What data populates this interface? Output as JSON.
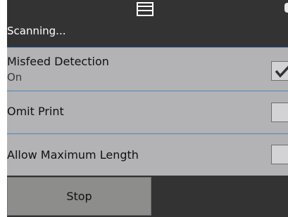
{
  "header": {
    "icon": "document-tray-icon",
    "status_text": "Scanning..."
  },
  "settings": [
    {
      "label": "Misfeed Detection",
      "value": "On",
      "checked": true
    },
    {
      "label": "Omit Print",
      "checked": false
    },
    {
      "label": "Allow Maximum Length",
      "checked": false
    }
  ],
  "footer": {
    "stop_label": "Stop"
  },
  "colors": {
    "header_bg": "#333333",
    "panel_bg": "#b3b2b4",
    "divider": "#4d86c2",
    "button_bg": "#8d8d8b"
  }
}
